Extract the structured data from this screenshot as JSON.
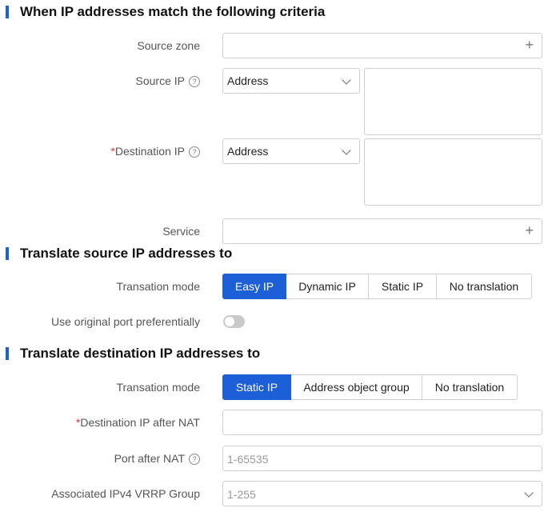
{
  "sections": {
    "match": {
      "title": "When IP addresses match the following criteria"
    },
    "source_translate": {
      "title": "Translate source IP addresses to"
    },
    "dest_translate": {
      "title": "Translate destination IP addresses to"
    }
  },
  "match": {
    "source_zone": {
      "label": "Source zone",
      "value": ""
    },
    "source_ip": {
      "label": "Source IP",
      "select_value": "Address",
      "help": "?"
    },
    "destination_ip": {
      "required": "*",
      "label": "Destination IP",
      "select_value": "Address",
      "help": "?"
    },
    "service": {
      "label": "Service",
      "value": ""
    }
  },
  "source_translate": {
    "mode_label": "Transation mode",
    "modes": [
      "Easy IP",
      "Dynamic IP",
      "Static IP",
      "No translation"
    ],
    "active_mode": "Easy IP",
    "original_port_label": "Use original port preferentially",
    "original_port_enabled": false
  },
  "dest_translate": {
    "mode_label": "Transation mode",
    "modes": [
      "Static IP",
      "Address object group",
      "No translation"
    ],
    "active_mode": "Static IP",
    "dest_ip_after_nat": {
      "required": "*",
      "label": "Destination IP after NAT",
      "value": ""
    },
    "port_after_nat": {
      "label": "Port after NAT",
      "help": "?",
      "placeholder": "1-65535"
    },
    "vrrp_group": {
      "label": "Associated IPv4 VRRP Group",
      "placeholder": "1-255"
    }
  },
  "icons": {
    "add": "plus-icon",
    "dropdown": "chevron-down-icon",
    "help": "question-circle-icon"
  },
  "colors": {
    "accent": "#1d5fd6",
    "required": "#e0393e"
  }
}
